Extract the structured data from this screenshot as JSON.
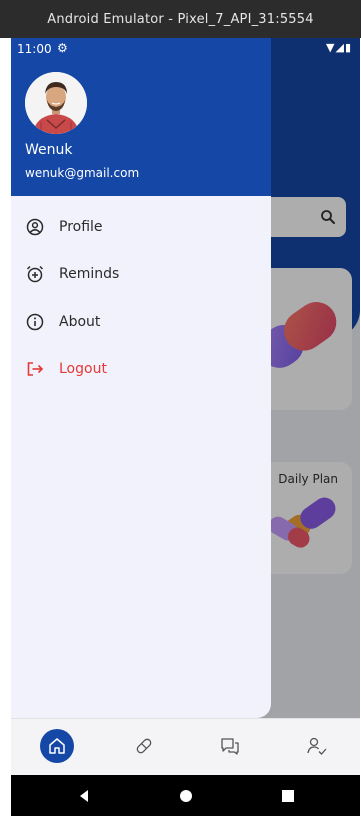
{
  "window": {
    "title": "Android Emulator - Pixel_7_API_31:5554"
  },
  "status_bar": {
    "time": "11:00"
  },
  "drawer": {
    "user_name": "Wenuk",
    "user_email": "wenuk@gmail.com",
    "items": [
      {
        "label": "Profile",
        "icon": "profile-icon"
      },
      {
        "label": "Reminds",
        "icon": "alarm-add-icon"
      },
      {
        "label": "About",
        "icon": "info-icon"
      },
      {
        "label": "Logout",
        "icon": "logout-icon",
        "color": "#e53935"
      }
    ]
  },
  "background": {
    "card_2_title": "Daily Plan"
  },
  "bottom_nav": {
    "items": [
      "home-icon",
      "pill-icon",
      "chat-icon",
      "user-check-icon"
    ]
  },
  "colors": {
    "primary": "#1547a7",
    "drawer_bg": "#f1f2fb",
    "logout": "#e53935"
  }
}
